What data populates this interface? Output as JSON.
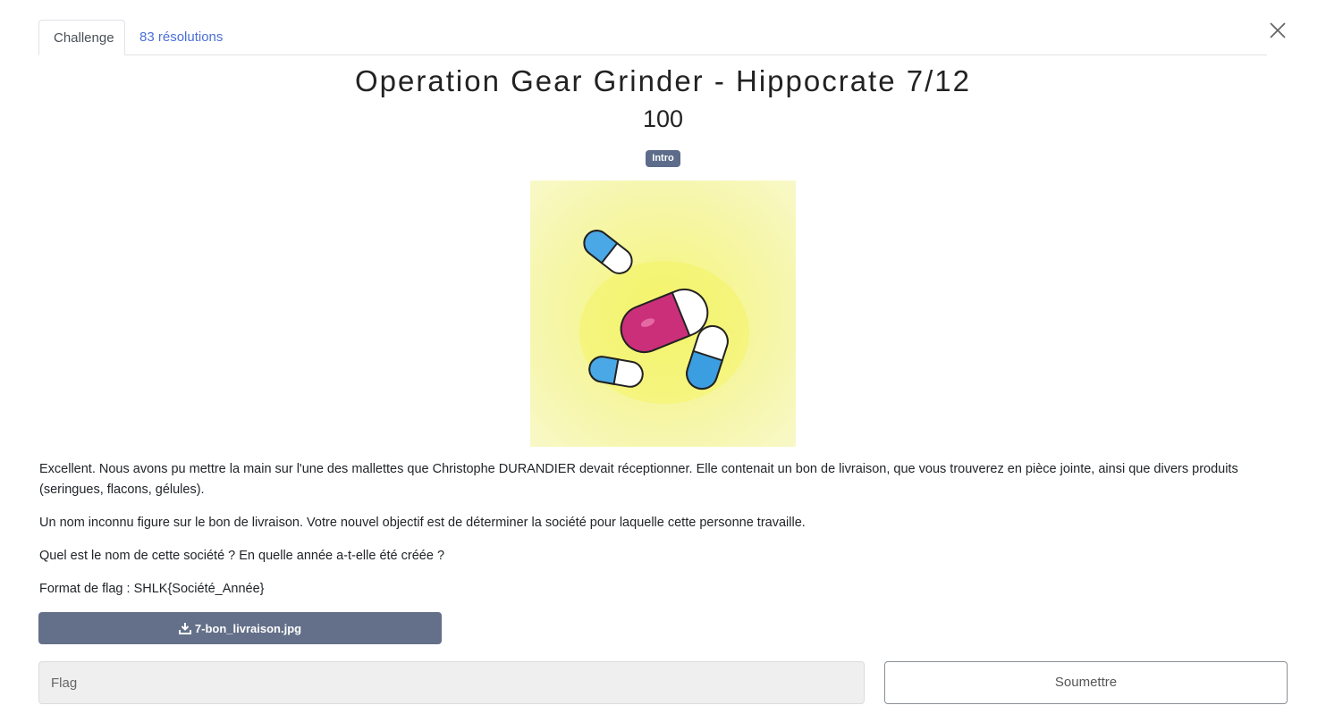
{
  "tabs": [
    {
      "label": "Challenge",
      "active": true
    },
    {
      "label": "83 résolutions",
      "active": false
    }
  ],
  "close_icon": "close-icon",
  "challenge": {
    "title": "Operation Gear Grinder - Hippocrate 7/12",
    "points": "100",
    "category": "Intro"
  },
  "description": {
    "p1": "Excellent. Nous avons pu mettre la main sur l'une des mallettes que Christophe DURANDIER devait réceptionner. Elle contenait un bon de livraison, que vous trouverez en pièce jointe, ainsi que divers produits (seringues, flacons, gélules).",
    "p2": "Un nom inconnu figure sur le bon de livraison. Votre nouvel objectif est de déterminer la société pour laquelle cette personne travaille.",
    "p3": "Quel est le nom de cette société ? En quelle année a-t-elle été créée ?",
    "p4": "Format de flag : SHLK{Société_Année}"
  },
  "attachment": {
    "filename": "7-bon_livraison.jpg",
    "icon": "download-icon"
  },
  "form": {
    "flag_placeholder": "Flag",
    "submit_label": "Soumettre"
  },
  "colors": {
    "badge": "#5c6c8a",
    "download_button": "#647089",
    "link": "#4a6fd8"
  }
}
